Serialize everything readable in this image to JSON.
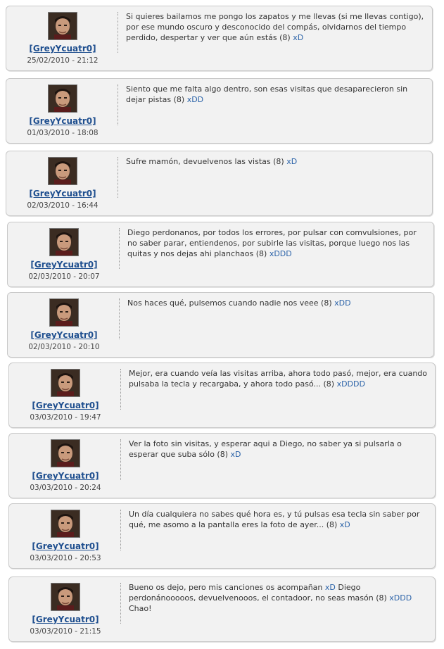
{
  "comments": [
    {
      "user": "[GreyYcuatr0]",
      "date": "25/02/2010 - 21:12",
      "text": "Si quieres bailamos me pongo los zapatos y me llevas (si me llevas contigo), por ese mundo oscuro y desconocido del compás, olvidarnos del tiempo perdido, despertar y ver que aún estás (8)",
      "xd": "xD",
      "tail": ""
    },
    {
      "user": "[GreyYcuatr0]",
      "date": "01/03/2010 - 18:08",
      "text": "Siento que me falta algo dentro, son esas visitas que desaparecieron sin dejar pistas (8)",
      "xd": "xDD",
      "tail": ""
    },
    {
      "user": "[GreyYcuatr0]",
      "date": "02/03/2010 - 16:44",
      "text": "Sufre mamón, devuelvenos las vistas (8)",
      "xd": "xD",
      "tail": ""
    },
    {
      "user": "[GreyYcuatr0]",
      "date": "02/03/2010 - 20:07",
      "text": "Diego perdonanos, por todos los errores, por pulsar con comvulsiones, por no saber parar, entiendenos, por subirle las visitas, porque luego nos las quitas y nos dejas ahi planchaos (8)",
      "xd": "xDDD",
      "tail": ""
    },
    {
      "user": "[GreyYcuatr0]",
      "date": "02/03/2010 - 20:10",
      "text": "Nos haces qué, pulsemos cuando nadie nos veee (8)",
      "xd": "xDD",
      "tail": ""
    },
    {
      "user": "[GreyYcuatr0]",
      "date": "03/03/2010 - 19:47",
      "text": "Mejor, era cuando veía las visitas arriba, ahora todo pasó, mejor, era cuando pulsaba la tecla y recargaba, y ahora todo pasó... (8)",
      "xd": "xDDDD",
      "tail": ""
    },
    {
      "user": "[GreyYcuatr0]",
      "date": "03/03/2010 - 20:24",
      "text": "Ver la foto sin visitas, y esperar aqui a Diego, no saber ya si pulsarla o esperar que suba sólo (8)",
      "xd": "xD",
      "tail": ""
    },
    {
      "user": "[GreyYcuatr0]",
      "date": "03/03/2010 - 20:53",
      "text": "Un día cualquiera no sabes qué hora es, y tú pulsas esa tecla sin saber por qué, me asomo a la pantalla eres la foto de ayer... (8)",
      "xd": "xD",
      "tail": ""
    },
    {
      "user": "[GreyYcuatr0]",
      "date": "03/03/2010 - 21:15",
      "text": "Bueno os dejo, pero mis canciones os acompañan",
      "xd": "xD",
      "tail": " Diego perdonánooooos, devuelvenooos, el contadoor, no seas masón (8) ",
      "xd2": "xDDD",
      "tail2": " Chao!"
    }
  ]
}
